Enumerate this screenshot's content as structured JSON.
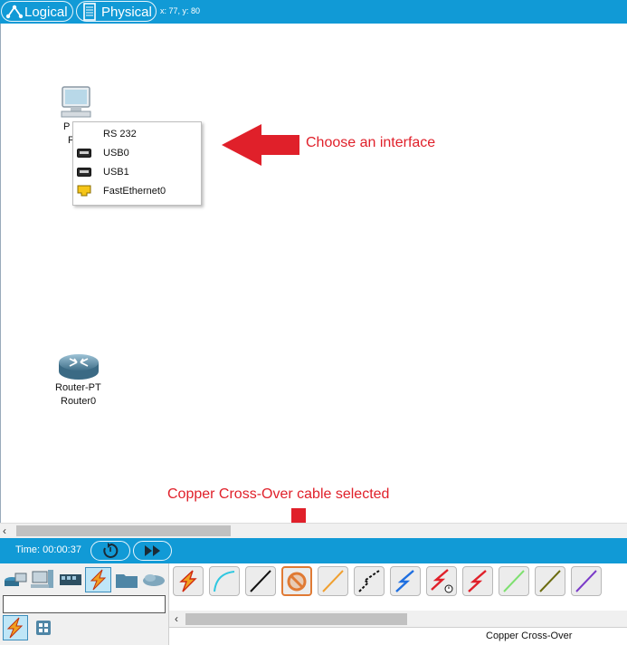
{
  "topbar": {
    "logical_label": "Logical",
    "physical_label": "Physical",
    "coords": "x: 77, y: 80"
  },
  "workspace": {
    "pc_label_fragment_1": "P",
    "pc_label_fragment_2": "F",
    "router": {
      "model": "Router-PT",
      "name": "Router0"
    },
    "interface_menu": [
      {
        "label": "RS 232",
        "icon": ""
      },
      {
        "label": "USB0",
        "icon": "usb-port-icon"
      },
      {
        "label": "USB1",
        "icon": "usb-port-icon"
      },
      {
        "label": "FastEthernet0",
        "icon": "ethernet-port-icon"
      }
    ],
    "annotation_menu": "Choose an interface",
    "annotation_cable": "Copper Cross-Over cable selected"
  },
  "timebar": {
    "time": "Time: 00:00:37"
  },
  "bottom": {
    "search_value": "",
    "cables": [
      {
        "name": "automatic",
        "icon": "lightning-icon"
      },
      {
        "name": "console",
        "icon": "console-cable-icon"
      },
      {
        "name": "copper-straight",
        "icon": "straight-cable-icon"
      },
      {
        "name": "copper-cross-over",
        "icon": "cross-over-cable-icon"
      },
      {
        "name": "fiber",
        "icon": "fiber-cable-icon"
      },
      {
        "name": "phone",
        "icon": "phone-cable-icon"
      },
      {
        "name": "coaxial",
        "icon": "coaxial-cable-icon"
      },
      {
        "name": "serial-dce",
        "icon": "serial-dce-icon"
      },
      {
        "name": "serial-dte",
        "icon": "serial-dte-icon"
      },
      {
        "name": "octal",
        "icon": "octal-cable-icon"
      },
      {
        "name": "iot",
        "icon": "iot-cable-icon"
      },
      {
        "name": "usb",
        "icon": "usb-cable-icon"
      }
    ],
    "selected_cable_name": "Copper Cross-Over"
  },
  "colors": {
    "bar_blue": "#119ad6",
    "annotation_red": "#e0202a",
    "selection_orange": "#e07a34"
  }
}
